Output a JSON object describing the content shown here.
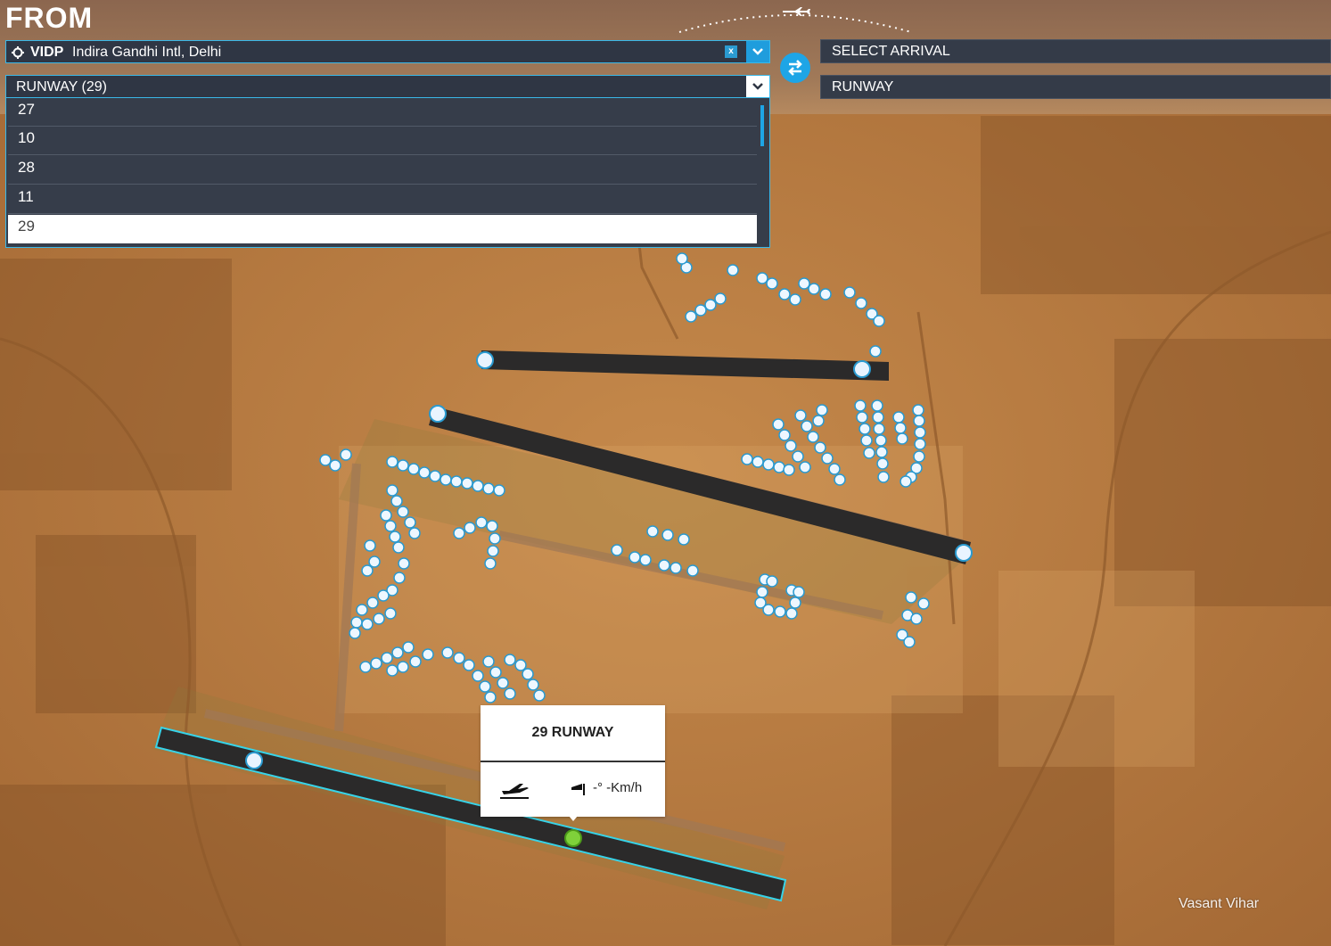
{
  "header": {
    "title": "FROM"
  },
  "departure": {
    "icao": "VIDP",
    "name": "Indira Gandhi Intl, Delhi",
    "clear_label": "x"
  },
  "departure_runway": {
    "label": "RUNWAY (29)",
    "options": [
      "27",
      "10",
      "28",
      "11",
      "29"
    ],
    "selected": "29"
  },
  "arrival": {
    "placeholder": "SELECT ARRIVAL",
    "runway_label": "RUNWAY"
  },
  "popup": {
    "title": "29 RUNWAY",
    "wind": "-° -Km/h"
  },
  "map": {
    "place_label": "Vasant Vihar"
  },
  "colors": {
    "accent": "#1ea5e6",
    "field_bg": "#2f3644",
    "runway_highlight": "#37d3e8",
    "threshold": "#7fd13a"
  }
}
